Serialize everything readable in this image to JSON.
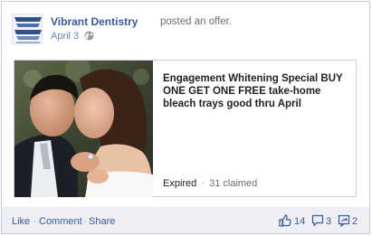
{
  "post": {
    "page_name": "Vibrant Dentistry",
    "action": "posted an offer.",
    "date": "April 3"
  },
  "offer": {
    "title": "Engagement Whitening Special BUY ONE GET ONE FREE take-home bleach trays good thru April",
    "status": "Expired",
    "separator": "·",
    "claims": "31 claimed"
  },
  "footer": {
    "like": "Like",
    "comment": "Comment",
    "share": "Share",
    "separator": "·",
    "likes_count": "14",
    "comments_count": "3",
    "shares_count": "2"
  },
  "icons": {
    "privacy": "globe-icon",
    "likes": "thumbs-up-icon",
    "comments": "speech-bubble-icon",
    "shares": "share-icon"
  },
  "colors": {
    "link": "#3b5998",
    "footer_bg": "#edeff4",
    "border": "#c4cde0"
  }
}
